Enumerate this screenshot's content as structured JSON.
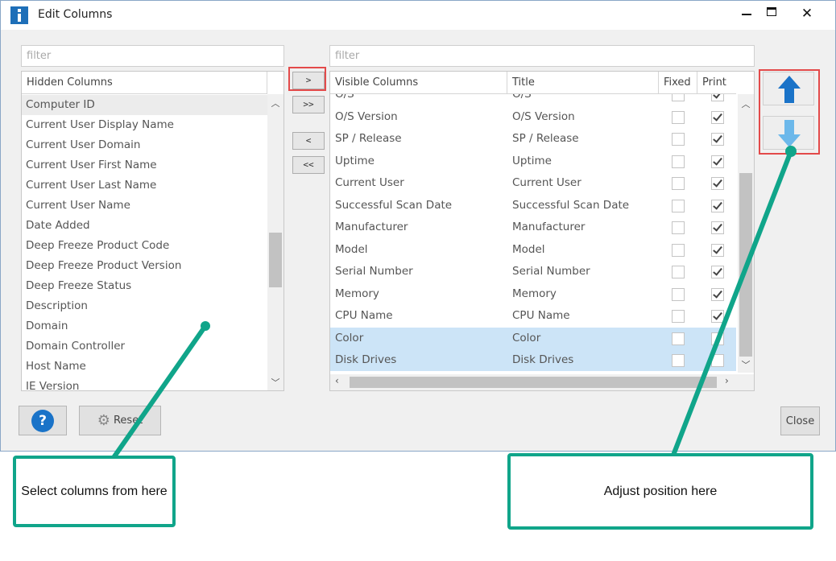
{
  "window": {
    "title": "Edit Columns",
    "minimize_icon": "minimize-icon",
    "maximize_icon": "maximize-icon",
    "close_glyph": "✕"
  },
  "hidden_panel": {
    "filter_placeholder": "filter",
    "header": "Hidden Columns",
    "items": [
      "Computer ID",
      "Current User Display Name",
      "Current User Domain",
      "Current User First Name",
      "Current User Last Name",
      "Current User Name",
      "Date Added",
      "Deep Freeze Product Code",
      "Deep Freeze Product Version",
      "Deep Freeze Status",
      "Description",
      "Domain",
      "Domain Controller",
      "Host Name",
      "IE Version"
    ],
    "selected_index": 0
  },
  "move_buttons": {
    "add": ">",
    "add_all": ">>",
    "remove": "<",
    "remove_all": "<<"
  },
  "visible_panel": {
    "filter_placeholder": "filter",
    "headers": {
      "visible_columns": "Visible Columns",
      "title": "Title",
      "fixed": "Fixed",
      "print": "Print"
    },
    "rows": [
      {
        "column": "O/S",
        "title": "O/S",
        "fixed": false,
        "print": true
      },
      {
        "column": "O/S Version",
        "title": "O/S Version",
        "fixed": false,
        "print": true
      },
      {
        "column": "SP / Release",
        "title": "SP / Release",
        "fixed": false,
        "print": true
      },
      {
        "column": "Uptime",
        "title": "Uptime",
        "fixed": false,
        "print": true
      },
      {
        "column": "Current User",
        "title": "Current User",
        "fixed": false,
        "print": true
      },
      {
        "column": "Successful Scan Date",
        "title": "Successful Scan Date",
        "fixed": false,
        "print": true
      },
      {
        "column": "Manufacturer",
        "title": "Manufacturer",
        "fixed": false,
        "print": true
      },
      {
        "column": "Model",
        "title": "Model",
        "fixed": false,
        "print": true
      },
      {
        "column": "Serial Number",
        "title": "Serial Number",
        "fixed": false,
        "print": true
      },
      {
        "column": "Memory",
        "title": "Memory",
        "fixed": false,
        "print": true
      },
      {
        "column": "CPU Name",
        "title": "CPU Name",
        "fixed": false,
        "print": true
      },
      {
        "column": "Color",
        "title": "Color",
        "fixed": false,
        "print": false
      },
      {
        "column": "Disk Drives",
        "title": "Disk Drives",
        "fixed": false,
        "print": false
      }
    ],
    "selected_rows": [
      11,
      12
    ]
  },
  "reorder": {
    "up_icon": "arrow-up-icon",
    "down_icon": "arrow-down-icon",
    "up_color": "#1a73c8",
    "down_color": "#6cb8ea"
  },
  "footer": {
    "help_glyph": "?",
    "reset_label": "Reset",
    "close_label": "Close"
  },
  "callouts": {
    "left": "Select columns from here",
    "right": "Adjust position here",
    "color": "#10a58a"
  },
  "highlight_color": "#e34a4a"
}
